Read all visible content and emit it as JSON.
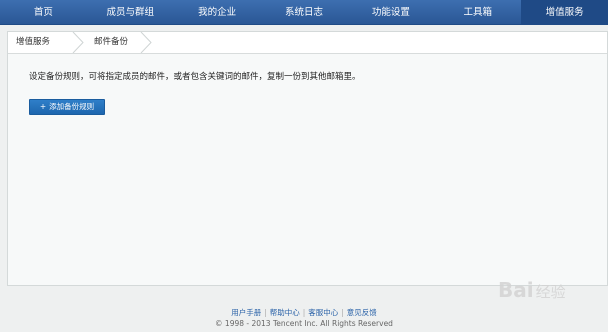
{
  "nav": {
    "items": [
      "首页",
      "成员与群组",
      "我的企业",
      "系统日志",
      "功能设置",
      "工具箱",
      "增值服务"
    ],
    "active_index": 6
  },
  "breadcrumb": {
    "items": [
      "增值服务",
      "邮件备份"
    ]
  },
  "content": {
    "description": "设定备份规则，可将指定成员的邮件，或者包含关键词的邮件，复制一份到其他邮箱里。",
    "add_button_label": "添加备份规则"
  },
  "footer": {
    "links": [
      "用户手册",
      "帮助中心",
      "客服中心",
      "意见反馈"
    ],
    "copyright": "© 1998 - 2013 Tencent Inc. All Rights Reserved"
  },
  "watermark": {
    "text": "Bai",
    "text2": "经验"
  },
  "icons": {
    "plus": "plus-icon",
    "breadcrumb_separator": "chevron-right-icon"
  },
  "colors": {
    "nav_bg": "#2a5795",
    "nav_active": "#1f4a86",
    "button_bg": "#1d66ae",
    "link": "#2a62a8"
  }
}
